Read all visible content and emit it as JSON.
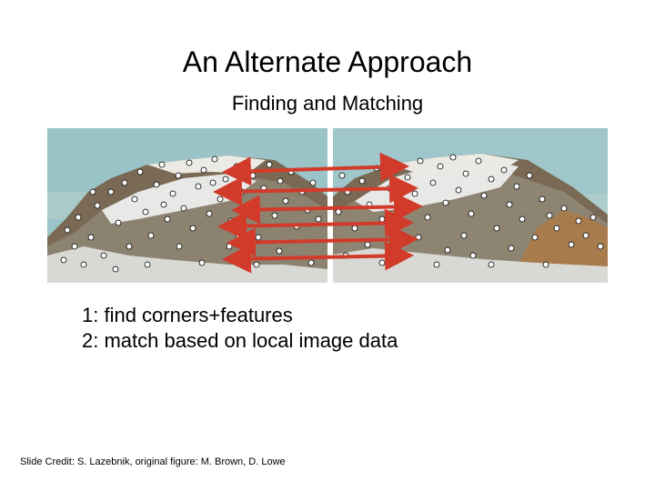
{
  "title": "An Alternate Approach",
  "subtitle": "Finding and Matching",
  "body": {
    "line1": "1: find corners+features",
    "line2": "2: match based on local image data"
  },
  "credit": "Slide Credit: S. Lazebnik, original figure: M. Brown, D. Lowe",
  "figure": {
    "description": "Two overlapping mountain photographs side by side, each covered with detected feature points (white dots with black outlines). Red double-headed arrows connect corresponding features between the left and right images.",
    "panel_count": 2,
    "arrow_count": 6
  }
}
